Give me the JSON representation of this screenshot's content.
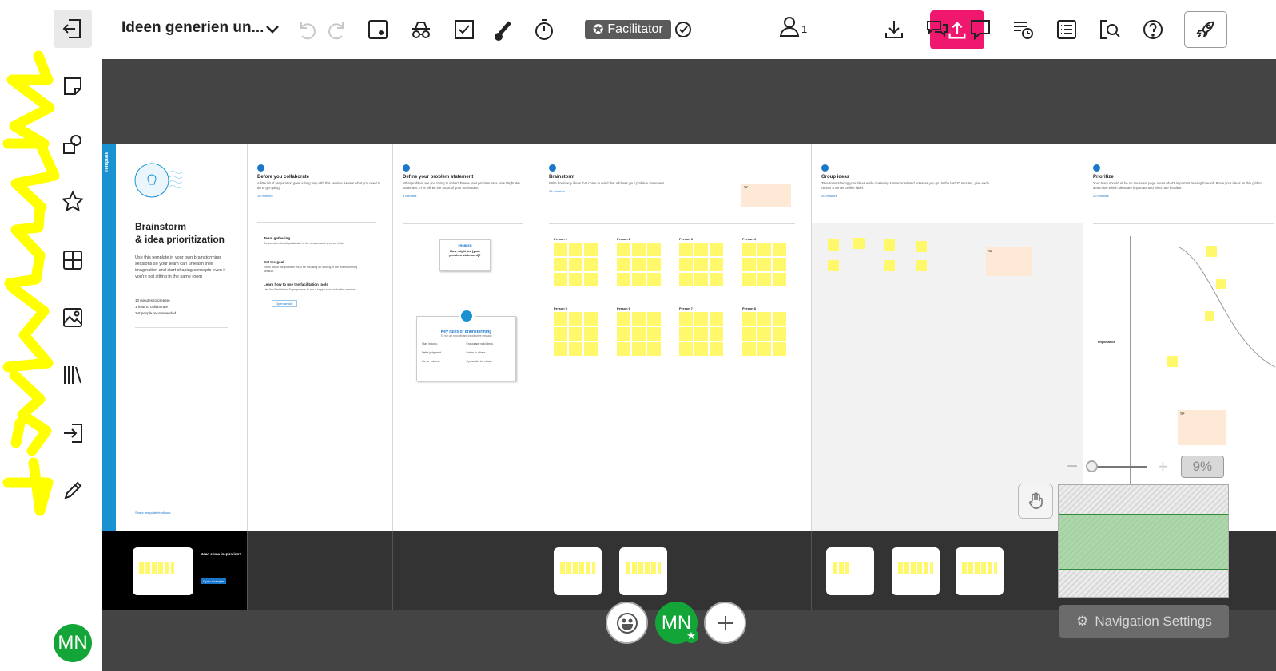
{
  "toolbar": {
    "board_title": "Ideen generien un...",
    "facilitator_label": "Facilitator",
    "user_count": "1"
  },
  "sidebar": {
    "avatar_initials": "MN"
  },
  "canvas": {
    "template_label": "Template",
    "cover": {
      "title_line1": "Brainstorm",
      "title_line2": "& idea prioritization",
      "description": "Use this template in your own brainstorming sessions so your team can unleash their imagination and start shaping concepts even if you're not sitting in the same room",
      "stat1": "10 minutes to prepare",
      "stat2": "1 hour to collaborate",
      "stat3": "2-8 people recommended",
      "feedback": "Share template feedback"
    },
    "frames": [
      {
        "title": "Before you collaborate",
        "text": "A little bit of preparation goes a long way with this session. Here's what you need to do to get going.",
        "time": "10 minutes"
      },
      {
        "title": "Define your problem statement",
        "text": "What problem are you trying to solve? Frame your problem as a How Might We statement. This will be the focus of your brainstorm.",
        "time": "5 minutes"
      },
      {
        "title": "Brainstorm",
        "text": "Write down any ideas that come to mind that address your problem statement.",
        "time": "10 minutes"
      },
      {
        "title": "Group ideas",
        "text": "Take turns sharing your ideas while clustering similar or related notes as you go. In the last 10 minutes, give each cluster a sentence-like label.",
        "time": "20 minutes"
      },
      {
        "title": "Prioritize",
        "text": "Your team should all be on the same page about what's important moving forward. Place your ideas on this grid to determine which ideas are important and which are feasible.",
        "time": "20 minutes"
      }
    ],
    "steps": [
      {
        "title": "Team gathering",
        "text": "Define who should participate in the session and send an invite."
      },
      {
        "title": "Set the goal",
        "text": "Think about the problem you'll be focusing on solving in the brainstorming session."
      },
      {
        "title": "Learn how to use the facilitation tools",
        "text": "Use the Facilitation Superpowers to run a happy and productive session."
      }
    ],
    "open_article": "Open article",
    "hmw_title": "PROBLEM",
    "hmw_text": "How might we [your problem statement]?",
    "rules_title": "Key rules of brainstorming",
    "rules_sub": "To run an smooth and productive session",
    "rules": [
      "Stay in topic.",
      "Encourage wild ideas.",
      "Defer judgment.",
      "Listen to others.",
      "Go for volume.",
      "If possible, be visual."
    ],
    "persons": [
      "Person 1",
      "Person 2",
      "Person 3",
      "Person 4",
      "Person 5",
      "Person 6",
      "Person 7",
      "Person 8"
    ],
    "tip_label": "TIP",
    "importance_label": "Importance",
    "inspiration_title": "Need some inspiration?",
    "inspiration_link": "Open example"
  },
  "zoom": {
    "value": "9%"
  },
  "navigation_settings": "Navigation Settings",
  "bottom_bar": {
    "avatar_initials": "MN"
  },
  "colors": {
    "accent_pink": "#f0186e",
    "avatar_green": "#13a538",
    "template_blue": "#1a92d2",
    "sticky_yellow": "#fff86b",
    "facilitator_gray": "#5a5a5a",
    "scribble_yellow": "#ffff00"
  }
}
